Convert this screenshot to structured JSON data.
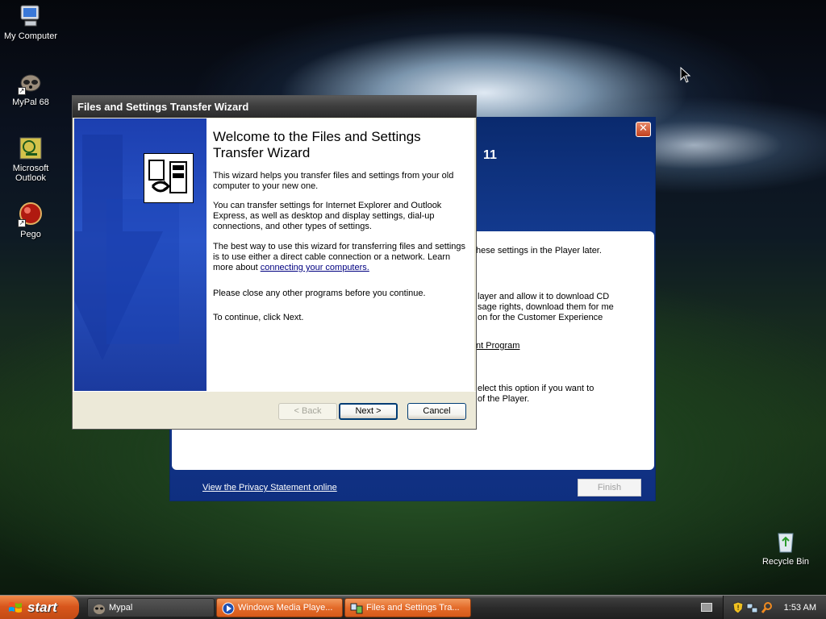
{
  "desktop": {
    "icons": [
      {
        "label": "My Computer"
      },
      {
        "label": "MyPal 68"
      },
      {
        "label": "Microsoft Outlook"
      },
      {
        "label": "Pego"
      },
      {
        "label": "Recycle Bin"
      }
    ]
  },
  "wmp": {
    "version_fragment": "11",
    "line1": "hese settings in the Player later.",
    "line2": "layer and allow it to download CD",
    "line3": "sage rights, download them for me",
    "line4": "on for the Customer Experience",
    "link_fragment": "nt Program",
    "line5": "elect this option if you want to",
    "line6": "of the Player.",
    "privacy_link": "View the Privacy Statement online",
    "finish_label": "Finish"
  },
  "wizard": {
    "title": "Files and Settings Transfer Wizard",
    "heading": "Welcome to the Files and Settings Transfer Wizard",
    "p1": "This wizard helps you transfer files and settings from your old computer to your new one.",
    "p2": "You can transfer settings for Internet Explorer and Outlook Express, as well as desktop and display settings, dial-up connections, and other types of settings.",
    "p3_before": "The best way to use this wizard for transferring files and settings is to use either a direct cable connection or a network. Learn more about ",
    "p3_link": "connecting your computers.",
    "p4": "Please close any other programs before you continue.",
    "p5": "To continue, click Next.",
    "back_label": "< Back",
    "next_label": "Next >",
    "cancel_label": "Cancel"
  },
  "taskbar": {
    "start_label": "start",
    "tasks": [
      {
        "label": "Mypal"
      },
      {
        "label": "Windows Media Playe..."
      },
      {
        "label": "Files and Settings Tra..."
      }
    ],
    "clock": "1:53 AM"
  }
}
